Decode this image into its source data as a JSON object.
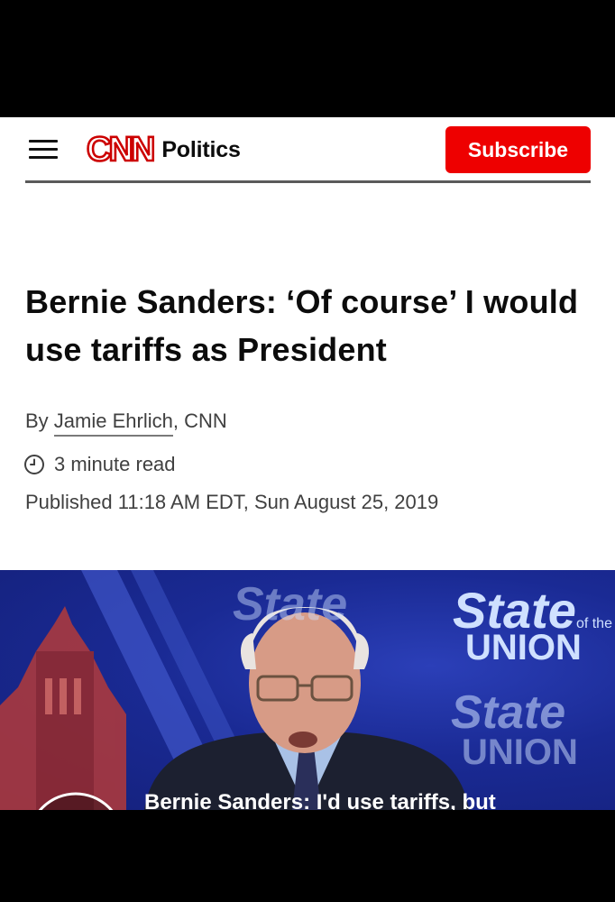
{
  "header": {
    "logo_text": "CNN",
    "section": "Politics",
    "subscribe_label": "Subscribe"
  },
  "article": {
    "headline": "Bernie Sanders: ‘Of course’ I would use tariffs as President",
    "byline_prefix": "By ",
    "author": "Jamie Ehrlich",
    "byline_suffix": ", CNN",
    "read_time": "3 minute read",
    "published": "Published 11:18 AM EDT, Sun August 25, 2019"
  },
  "video": {
    "caption": "Bernie Sanders: I'd use tariffs, but",
    "backdrop_title": "State",
    "backdrop_small": "of the",
    "backdrop_union": "UNION"
  },
  "colors": {
    "brand_red": "#cc0000",
    "subscribe_bg": "#ee0000",
    "video_blue": "#1a2a94"
  }
}
